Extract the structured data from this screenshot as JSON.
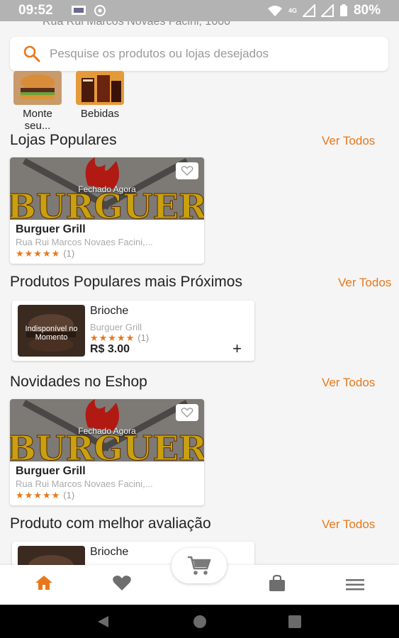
{
  "status": {
    "time": "09:52",
    "network": "4G",
    "battery": "80%"
  },
  "address": {
    "text": "Rua Rui Marcos Novaes Facini, 1000"
  },
  "search": {
    "placeholder": "Pesquise os produtos ou lojas desejados"
  },
  "categories": [
    {
      "label": "Monte seu...",
      "icon": "burger-image"
    },
    {
      "label": "Bebidas",
      "icon": "drinks-image"
    }
  ],
  "sections": {
    "popular_stores": {
      "title": "Lojas Populares",
      "see_all": "Ver Todos"
    },
    "popular_products": {
      "title": "Produtos Populares mais Próximos",
      "see_all": "Ver Todos"
    },
    "new_in_shop": {
      "title": "Novidades no Eshop",
      "see_all": "Ver Todos"
    },
    "top_rated": {
      "title": "Produto com melhor avaliação",
      "see_all": "Ver Todos"
    }
  },
  "store": {
    "name": "Burguer Grill",
    "address": "Rua Rui Marcos Novaes Facini,...",
    "status": "Fechado Agora",
    "logo_text": "BURGUER",
    "rating": 5,
    "stars": "★★★★★",
    "reviews": "(1)"
  },
  "product": {
    "name": "Brioche",
    "store": "Burguer Grill",
    "availability": "Indisponível no Momento",
    "stars": "★★★★★",
    "reviews": "(1)",
    "price": "R$ 3.00",
    "add_label": "+"
  },
  "nav": [
    "home-icon",
    "heart-icon",
    "cart-icon",
    "bag-icon",
    "menu-icon"
  ],
  "colors": {
    "accent": "#e8781b",
    "nav_active": "#e8781b",
    "nav_inactive": "#6e6e6e"
  }
}
